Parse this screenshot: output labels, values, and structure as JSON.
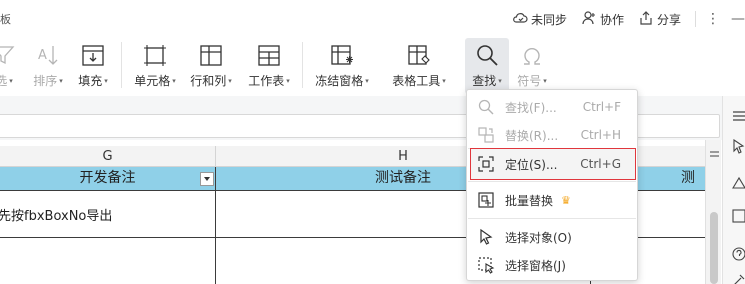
{
  "doc_title": "板",
  "top_actions": {
    "sync": "未同步",
    "collaborate": "协作",
    "share": "分享"
  },
  "ribbon": {
    "filter": "选",
    "sort": "排序",
    "fill": "填充",
    "cell": "单元格",
    "rows_cols": "行和列",
    "worksheet": "工作表",
    "freeze": "冻结窗格",
    "table_tools": "表格工具",
    "find": "查找",
    "symbol": "符号"
  },
  "columns": {
    "g": "G",
    "h": "H"
  },
  "sheet": {
    "header_g": "开发备注",
    "header_h": "测试备注",
    "header_i": "测试",
    "cell_g2": "先按fbxBoxNo导出"
  },
  "menu": {
    "items": [
      {
        "label": "查找(F)...",
        "shortcut": "Ctrl+F"
      },
      {
        "label": "替换(R)...",
        "shortcut": "Ctrl+H"
      },
      {
        "label": "定位(S)...",
        "shortcut": "Ctrl+G"
      },
      {
        "label": "批量替换",
        "shortcut": ""
      },
      {
        "label": "选择对象(O)",
        "shortcut": ""
      },
      {
        "label": "选择窗格(J)",
        "shortcut": ""
      }
    ]
  },
  "colors": {
    "header_fill": "#8fd0e8",
    "highlight_border": "#e0363c",
    "crown": "#f4a51c"
  }
}
